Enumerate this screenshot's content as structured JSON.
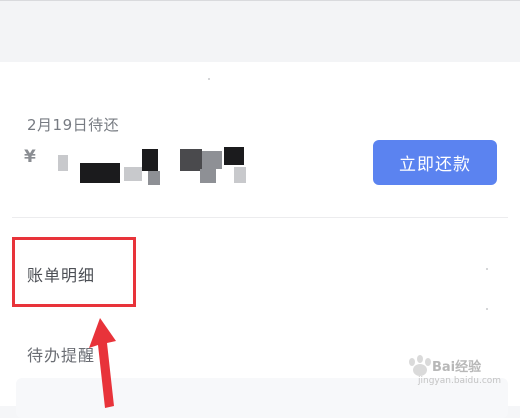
{
  "header": {
    "bg_color": "#f3f4f6"
  },
  "repayment": {
    "due_label": "2月19日待还",
    "currency_symbol": "¥",
    "pay_button_label": "立即还款",
    "button_color": "#5b83f0"
  },
  "menu": {
    "bill_detail_label": "账单明细",
    "todo_label": "待办提醒"
  },
  "annotation": {
    "highlight_color": "#e8333a",
    "arrow_icon": "red-arrow-up-icon"
  },
  "watermark": {
    "text": "Bai经验",
    "sub_text": "jingyan.baidu.com"
  }
}
